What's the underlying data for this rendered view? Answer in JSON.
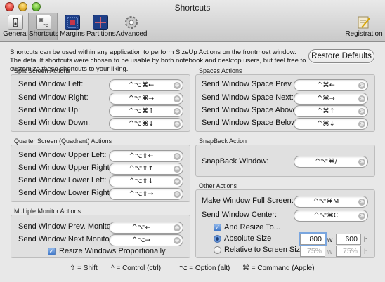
{
  "window": {
    "title": "Shortcuts"
  },
  "toolbar": {
    "items": [
      {
        "label": "General",
        "icon": "general-icon"
      },
      {
        "label": "Shortcuts",
        "icon": "keyboard-icon",
        "selected": true
      },
      {
        "label": "Margins",
        "icon": "margins-icon"
      },
      {
        "label": "Partitions",
        "icon": "partitions-icon"
      },
      {
        "label": "Advanced",
        "icon": "gear-icon"
      },
      {
        "label": "Registration",
        "icon": "registration-icon"
      }
    ]
  },
  "intro": {
    "text": "Shortcuts can be used within any application to perform SizeUp Actions on the frontmost window. The default shortcuts were chosen to be usable by both notebook and desktop users, but feel free to customize these shortcuts to your liking."
  },
  "restore_button": "Restore Defaults",
  "clear_glyph": "⊗",
  "groups": {
    "split": {
      "title": "Split Screen Actions",
      "rows": [
        {
          "label": "Send Window Left:",
          "shortcut": "^⌥⌘←"
        },
        {
          "label": "Send Window Right:",
          "shortcut": "^⌥⌘→"
        },
        {
          "label": "Send Window Up:",
          "shortcut": "^⌥⌘↑"
        },
        {
          "label": "Send Window Down:",
          "shortcut": "^⌥⌘↓"
        }
      ]
    },
    "quarter": {
      "title": "Quarter Screen (Quadrant) Actions",
      "rows": [
        {
          "label": "Send Window Upper Left:",
          "shortcut": "^⌥⇧←"
        },
        {
          "label": "Send Window Upper Right:",
          "shortcut": "^⌥⇧↑"
        },
        {
          "label": "Send Window Lower Left:",
          "shortcut": "^⌥⇧↓"
        },
        {
          "label": "Send Window Lower Right:",
          "shortcut": "^⌥⇧→"
        }
      ]
    },
    "monitor": {
      "title": "Multiple Monitor Actions",
      "rows": [
        {
          "label": "Send Window Prev. Monitor:",
          "shortcut": "^⌥←"
        },
        {
          "label": "Send Window Next Monitor:",
          "shortcut": "^⌥→"
        }
      ],
      "resize_checkbox": {
        "label": "Resize Windows Proportionally",
        "checked": true
      }
    },
    "spaces": {
      "title": "Spaces Actions",
      "rows": [
        {
          "label": "Send Window Space Prev.:",
          "shortcut": "^⌘←"
        },
        {
          "label": "Send Window Space Next:",
          "shortcut": "^⌘→"
        },
        {
          "label": "Send Window Space Above:",
          "shortcut": "^⌘↑"
        },
        {
          "label": "Send Window Space Below:",
          "shortcut": "^⌘↓"
        }
      ]
    },
    "snapback": {
      "title": "SnapBack Action",
      "rows": [
        {
          "label": "SnapBack Window:",
          "shortcut": "^⌥⌘/"
        }
      ]
    },
    "other": {
      "title": "Other Actions",
      "rows": [
        {
          "label": "Make Window Full Screen:",
          "shortcut": "^⌥⌘M"
        },
        {
          "label": "Send Window Center:",
          "shortcut": "^⌥⌘C"
        }
      ],
      "and_resize": {
        "label": "And Resize To...",
        "checked": true
      },
      "absolute": {
        "label": "Absolute Size",
        "selected": true,
        "w": "800",
        "h": "600",
        "w_unit": "w",
        "h_unit": "h"
      },
      "relative": {
        "label": "Relative to Screen Size",
        "selected": false,
        "w": "75%",
        "h": "75%",
        "w_unit": "w",
        "h_unit": "h"
      }
    }
  },
  "legend": {
    "shift": "⇧ = Shift",
    "control": "^ = Control (ctrl)",
    "option": "⌥ = Option (alt)",
    "command": "⌘ = Command (Apple)"
  },
  "colors": {
    "accent": "#3f77c9",
    "toolbar_selected": "#bdbdbd"
  }
}
